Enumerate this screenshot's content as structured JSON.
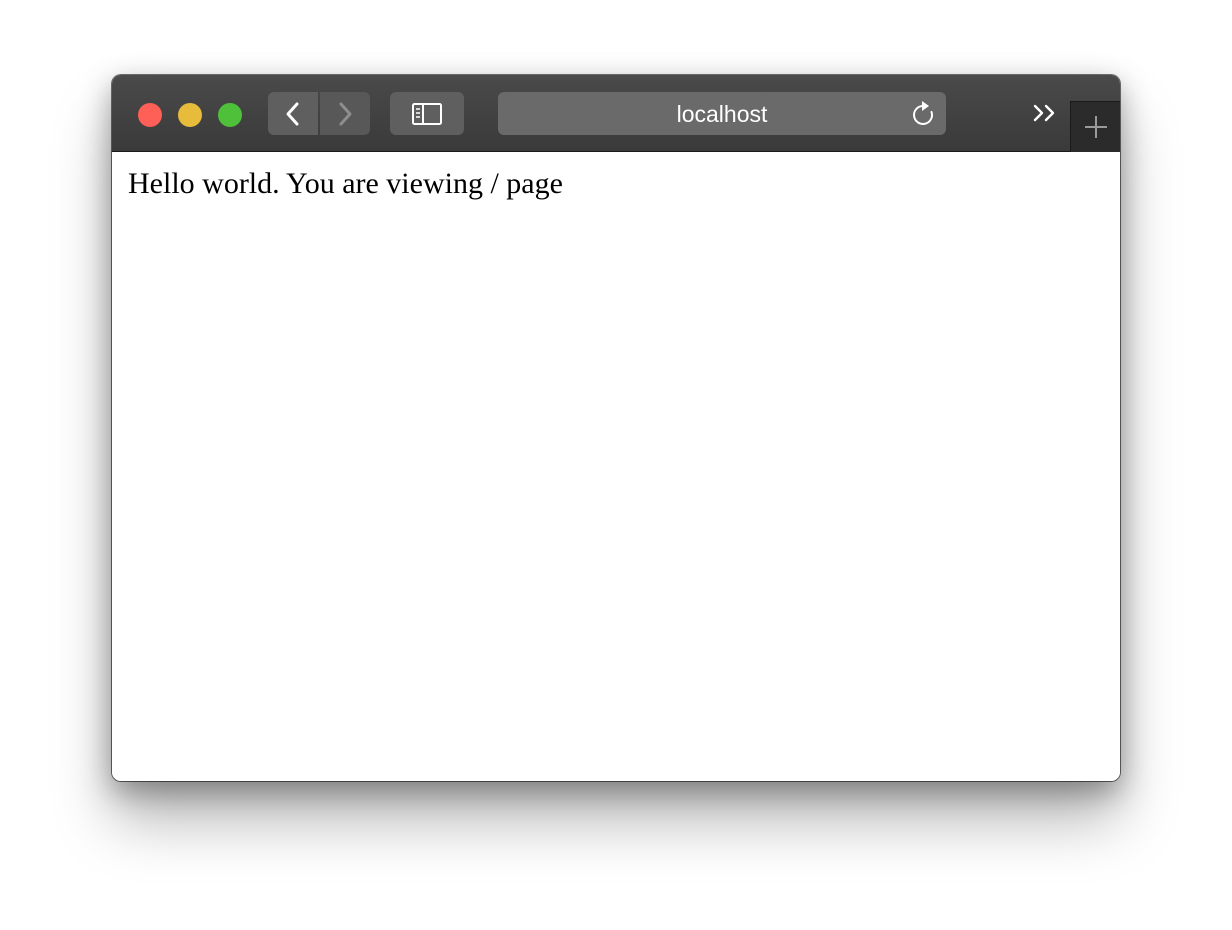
{
  "browser": {
    "address_bar": {
      "url": "localhost"
    },
    "toolbar": {
      "icons": [
        "close-icon",
        "minimize-icon",
        "zoom-icon",
        "chevron-left-icon",
        "chevron-right-icon",
        "sidebar-icon",
        "reload-icon",
        "double-chevron-right-icon",
        "plus-icon"
      ]
    },
    "colors": {
      "close": "#fe5f57",
      "minimize": "#e6bc3a",
      "zoom": "#4fc039",
      "toolbar": "#404040"
    }
  },
  "page": {
    "body_text": "Hello world. You are viewing / page"
  }
}
